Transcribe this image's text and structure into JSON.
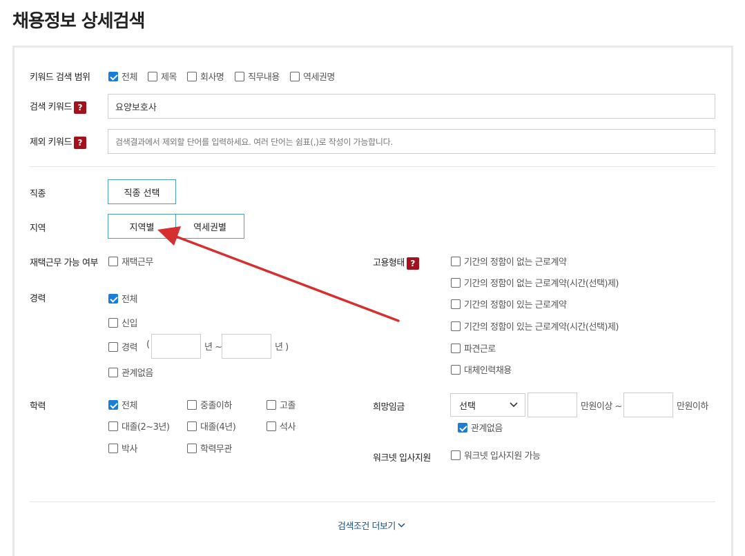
{
  "page": {
    "title": "채용정보 상세검색"
  },
  "keyword_scope": {
    "label": "키워드 검색 범위",
    "options": [
      {
        "label": "전체",
        "checked": true
      },
      {
        "label": "제목",
        "checked": false
      },
      {
        "label": "회사명",
        "checked": false
      },
      {
        "label": "직무내용",
        "checked": false
      },
      {
        "label": "역세권명",
        "checked": false
      }
    ]
  },
  "search_keyword": {
    "label": "검색 키워드",
    "value": "요양보호사",
    "help": "?"
  },
  "exclude_keyword": {
    "label": "제외 키워드",
    "help": "?",
    "placeholder": "검색결과에서 제외할 단어를 입력하세요. 여러 단어는 쉼표(,)로 작성이 가능합니다."
  },
  "job_type": {
    "label": "직종",
    "button": "직종 선택"
  },
  "region": {
    "label": "지역",
    "tabs": [
      "지역별",
      "역세권별"
    ]
  },
  "remote": {
    "label": "재택근무 가능 여부",
    "option": {
      "label": "재택근무",
      "checked": false
    }
  },
  "career": {
    "label": "경력",
    "options": [
      {
        "label": "전체",
        "checked": true
      },
      {
        "label": "신입",
        "checked": false
      },
      {
        "label": "경력",
        "checked": false
      },
      {
        "label": "관계없음",
        "checked": false
      }
    ],
    "range": {
      "open": "(",
      "from_unit": "년 ~",
      "to_unit": "년 )"
    }
  },
  "employment_type": {
    "label": "고용형태",
    "help": "?",
    "options": [
      {
        "label": "기간의 정함이 없는 근로계약",
        "checked": false
      },
      {
        "label": "기간의 정함이 없는 근로계약(시간(선택)제)",
        "checked": false
      },
      {
        "label": "기간의 정함이 있는 근로계약",
        "checked": false
      },
      {
        "label": "기간의 정함이 있는 근로계약(시간(선택)제)",
        "checked": false
      },
      {
        "label": "파견근로",
        "checked": false
      },
      {
        "label": "대체인력채용",
        "checked": false
      }
    ]
  },
  "education": {
    "label": "학력",
    "options": [
      {
        "label": "전체",
        "checked": true
      },
      {
        "label": "중졸이하",
        "checked": false
      },
      {
        "label": "고졸",
        "checked": false
      },
      {
        "label": "대졸(2~3년)",
        "checked": false
      },
      {
        "label": "대졸(4년)",
        "checked": false
      },
      {
        "label": "석사",
        "checked": false
      },
      {
        "label": "박사",
        "checked": false
      },
      {
        "label": "학력무관",
        "checked": false
      }
    ]
  },
  "salary": {
    "label": "희망임금",
    "select_value": "선택",
    "min_unit": "만원이상 ~",
    "max_unit": "만원이하",
    "no_matter": {
      "label": "관계없음",
      "checked": true
    }
  },
  "worknet_apply": {
    "label": "워크넷 입사지원",
    "option": {
      "label": "워크넷 입사지원 가능",
      "checked": false
    }
  },
  "more_conditions": {
    "label": "검색조건 더보기"
  },
  "colors": {
    "checkbox": "#1a7dd7",
    "help_badge": "#a3121c",
    "annotation_arrow": "#d62f2f",
    "button_border": "#4a9bc4"
  },
  "icons": {
    "dropdown": "chevron-down-icon",
    "more": "chevron-down-icon",
    "help": "question-icon"
  }
}
